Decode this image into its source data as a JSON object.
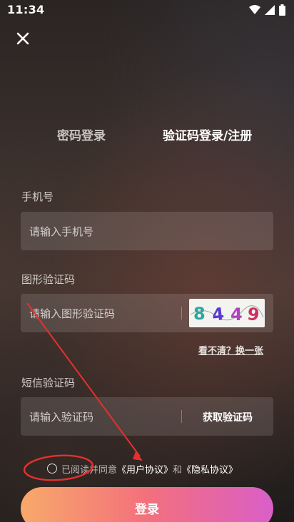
{
  "status": {
    "time": "11:34"
  },
  "tabs": {
    "password_login": "密码登录",
    "sms_login": "验证码登录/注册"
  },
  "phone": {
    "label": "手机号",
    "placeholder": "请输入手机号"
  },
  "captcha": {
    "label": "图形验证码",
    "placeholder": "请输入图形验证码",
    "image_text": "8 4 4 9",
    "refresh": "看不清？换一张"
  },
  "sms": {
    "label": "短信验证码",
    "placeholder": "请输入验证码",
    "get_code": "获取验证码"
  },
  "agreement": {
    "prefix": "已阅读并同意",
    "user_agreement": "《用户协议》",
    "and": "和",
    "privacy": "《隐私协议》",
    "checked": false
  },
  "login_button": "登录",
  "colors": {
    "annotation": "#e53030",
    "button_start": "#f8a96a",
    "button_end": "#d95fc8"
  },
  "icons": [
    "wifi-icon",
    "signal-icon",
    "battery-icon",
    "close-icon",
    "radio-icon"
  ]
}
